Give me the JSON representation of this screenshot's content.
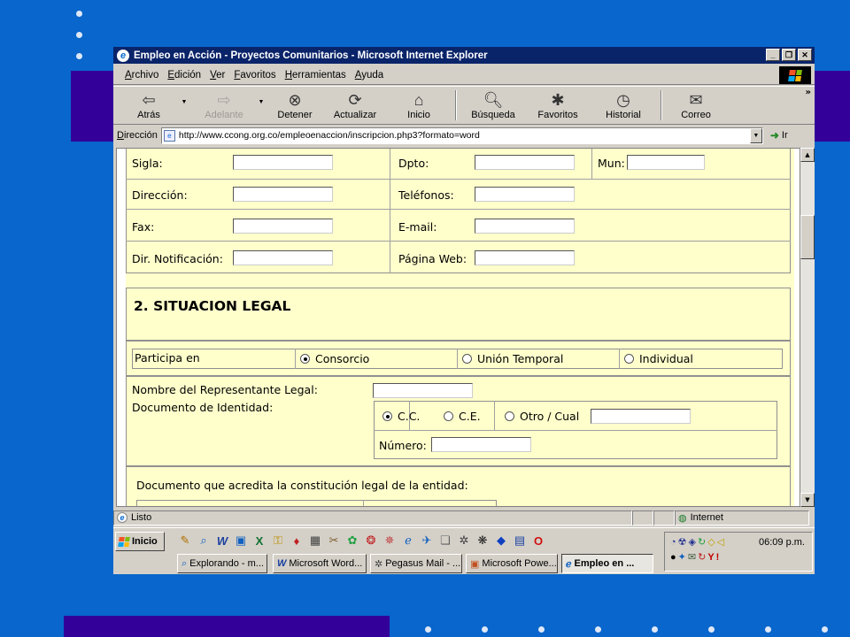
{
  "browser": {
    "title": "Empleo en Acción - Proyectos Comunitarios - Microsoft Internet Explorer",
    "menu": [
      "Archivo",
      "Edición",
      "Ver",
      "Favoritos",
      "Herramientas",
      "Ayuda"
    ],
    "toolbar": [
      {
        "label": "Atrás",
        "icon": "back-arrow-icon"
      },
      {
        "label": "Adelante",
        "icon": "forward-arrow-icon"
      },
      {
        "label": "Detener",
        "icon": "stop-icon"
      },
      {
        "label": "Actualizar",
        "icon": "refresh-icon"
      },
      {
        "label": "Inicio",
        "icon": "home-icon"
      },
      {
        "label": "Búsqueda",
        "icon": "search-icon"
      },
      {
        "label": "Favoritos",
        "icon": "favorites-icon"
      },
      {
        "label": "Historial",
        "icon": "history-icon"
      },
      {
        "label": "Correo",
        "icon": "mail-icon"
      }
    ],
    "address_label": "Dirección",
    "url": "http://www.ccong.org.co/empleoenaccion/inscripcion.php3?formato=word",
    "go_label": "Ir",
    "status": "Listo",
    "zone": "Internet"
  },
  "form": {
    "row1": {
      "sigla": "Sigla:",
      "dpto": "Dpto:",
      "mun": "Mun:"
    },
    "row2": {
      "direccion": "Dirección:",
      "telefonos": "Teléfonos:"
    },
    "row3": {
      "fax": "Fax:",
      "email": "E-mail:"
    },
    "row4": {
      "dir_notif": "Dir. Notificación:",
      "pagina_web": "Página Web:"
    },
    "section2_title": "2. SITUACION LEGAL",
    "participa_label": "Participa en",
    "participa_options": [
      "Consorcio",
      "Unión Temporal",
      "Individual"
    ],
    "participa_selected": "Consorcio",
    "representante_label": "Nombre del Representante Legal:",
    "documento_label": "Documento de Identidad:",
    "doc_options": [
      "C.C.",
      "C.E.",
      "Otro / Cual"
    ],
    "doc_selected": "C.C.",
    "numero_label": "Número:",
    "acredita_label": "Documento que acredita la constitución legal de la entidad:"
  },
  "taskbar": {
    "start_label": "Inicio",
    "tasks": [
      "Explorando - m...",
      "Microsoft Word...",
      "Pegasus Mail - ...",
      "Microsoft Powe...",
      "Empleo en ..."
    ],
    "active_task": "Empleo en ...",
    "clock": "06:09 p.m."
  },
  "colors": {
    "slide_background": "#0866cc",
    "slide_band": "#330099",
    "form_background": "#ffffcc",
    "titlebar": "#0a246a"
  }
}
